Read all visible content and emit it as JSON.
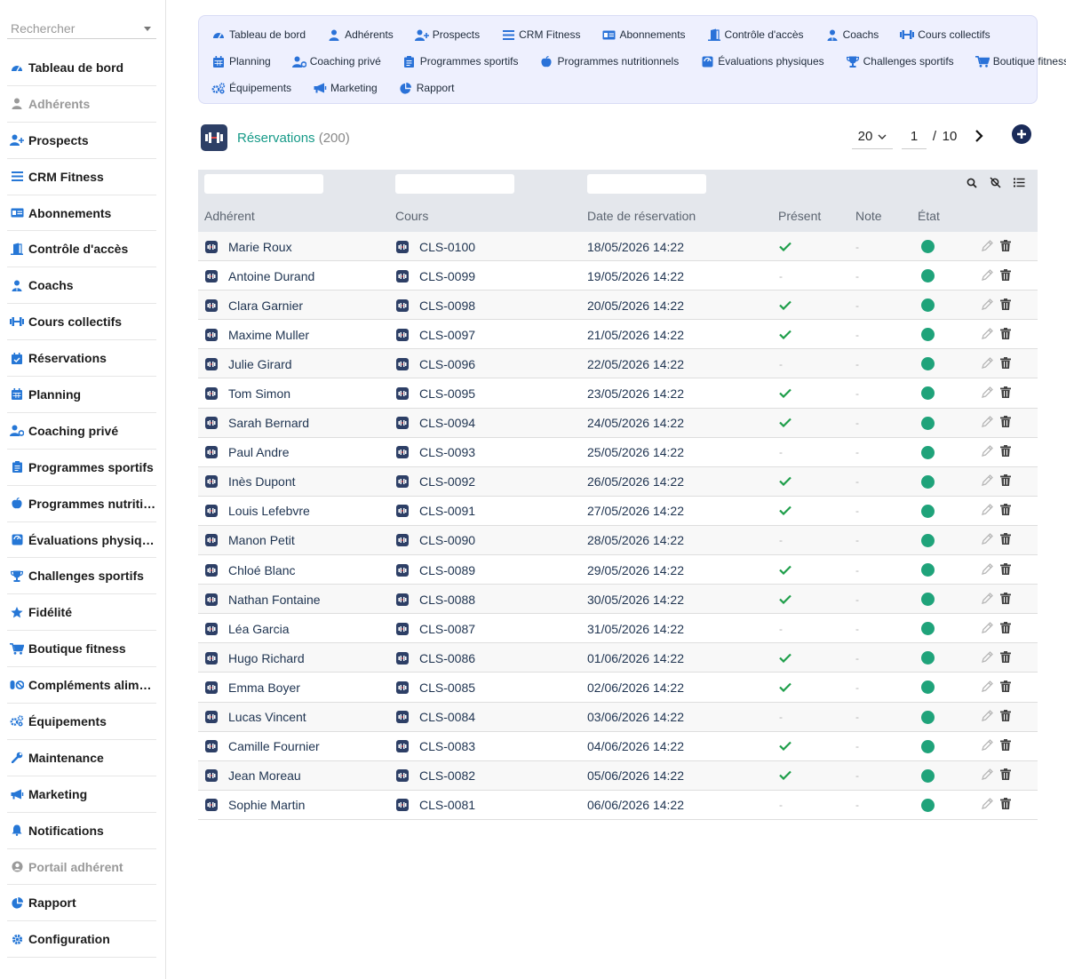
{
  "sidebar": {
    "search_placeholder": "Rechercher",
    "items": [
      {
        "label": "Tableau de bord",
        "icon": "dashboard-icon",
        "muted": false
      },
      {
        "label": "Adhérents",
        "icon": "user-icon",
        "muted": true
      },
      {
        "label": "Prospects",
        "icon": "user-plus-icon",
        "muted": false
      },
      {
        "label": "CRM Fitness",
        "icon": "list-icon",
        "muted": false
      },
      {
        "label": "Abonnements",
        "icon": "id-card-icon",
        "muted": false
      },
      {
        "label": "Contrôle d'accès",
        "icon": "door-icon",
        "muted": false
      },
      {
        "label": "Coachs",
        "icon": "coach-icon",
        "muted": false
      },
      {
        "label": "Cours collectifs",
        "icon": "dumbbell-icon",
        "muted": false
      },
      {
        "label": "Réservations",
        "icon": "calendar-check-icon",
        "muted": false
      },
      {
        "label": "Planning",
        "icon": "calendar-icon",
        "muted": false
      },
      {
        "label": "Coaching privé",
        "icon": "user-cog-icon",
        "muted": false
      },
      {
        "label": "Programmes sportifs",
        "icon": "clipboard-icon",
        "muted": false
      },
      {
        "label": "Programmes nutritionnels",
        "icon": "apple-icon",
        "muted": false
      },
      {
        "label": "Évaluations physiques",
        "icon": "scale-icon",
        "muted": false
      },
      {
        "label": "Challenges sportifs",
        "icon": "trophy-icon",
        "muted": false
      },
      {
        "label": "Fidélité",
        "icon": "star-icon",
        "muted": false
      },
      {
        "label": "Boutique fitness",
        "icon": "cart-icon",
        "muted": false
      },
      {
        "label": "Compléments alimentaires",
        "icon": "pills-icon",
        "muted": false
      },
      {
        "label": "Équipements",
        "icon": "gears-icon",
        "muted": false
      },
      {
        "label": "Maintenance",
        "icon": "wrench-icon",
        "muted": false
      },
      {
        "label": "Marketing",
        "icon": "megaphone-icon",
        "muted": false
      },
      {
        "label": "Notifications",
        "icon": "bell-icon",
        "muted": false
      },
      {
        "label": "Portail adhérent",
        "icon": "user-circle-icon",
        "muted": true
      },
      {
        "label": "Rapport",
        "icon": "pie-icon",
        "muted": false
      },
      {
        "label": "Configuration",
        "icon": "gear-icon",
        "muted": false
      }
    ]
  },
  "topnav": {
    "rows": [
      [
        {
          "label": "Tableau de bord",
          "icon": "dashboard-icon"
        },
        {
          "label": "Adhérents",
          "icon": "user-icon"
        },
        {
          "label": "Prospects",
          "icon": "user-plus-icon"
        },
        {
          "label": "CRM Fitness",
          "icon": "list-icon"
        },
        {
          "label": "Abonnements",
          "icon": "id-card-icon"
        },
        {
          "label": "Contrôle d'accès",
          "icon": "door-icon"
        },
        {
          "label": "Coachs",
          "icon": "coach-icon"
        },
        {
          "label": "Cours collectifs",
          "icon": "dumbbell-icon"
        }
      ],
      [
        {
          "label": "Planning",
          "icon": "calendar-icon"
        },
        {
          "label": "Coaching privé",
          "icon": "user-cog-icon"
        },
        {
          "label": "Programmes sportifs",
          "icon": "clipboard-icon"
        },
        {
          "label": "Programmes nutritionnels",
          "icon": "apple-icon"
        },
        {
          "label": "Évaluations physiques",
          "icon": "scale-icon"
        },
        {
          "label": "Challenges sportifs",
          "icon": "trophy-icon"
        },
        {
          "label": "Boutique fitness",
          "icon": "cart-icon"
        }
      ],
      [
        {
          "label": "Équipements",
          "icon": "gears-icon"
        },
        {
          "label": "Marketing",
          "icon": "megaphone-icon"
        },
        {
          "label": "Rapport",
          "icon": "pie-icon"
        }
      ]
    ]
  },
  "header": {
    "title": "Réservations",
    "count": "(200)",
    "per_page": "20",
    "page_current": "1",
    "page_sep": "/",
    "page_total": "10"
  },
  "table": {
    "columns": [
      "Adhérent",
      "Cours",
      "Date de réservation",
      "Présent",
      "Note",
      "État"
    ],
    "rows": [
      {
        "member": "Marie Roux",
        "course": "CLS-0100",
        "date": "18/05/2026 14:22",
        "present": true,
        "note": "-"
      },
      {
        "member": "Antoine Durand",
        "course": "CLS-0099",
        "date": "19/05/2026 14:22",
        "present": false,
        "note": "-"
      },
      {
        "member": "Clara Garnier",
        "course": "CLS-0098",
        "date": "20/05/2026 14:22",
        "present": true,
        "note": "-"
      },
      {
        "member": "Maxime Muller",
        "course": "CLS-0097",
        "date": "21/05/2026 14:22",
        "present": true,
        "note": "-"
      },
      {
        "member": "Julie Girard",
        "course": "CLS-0096",
        "date": "22/05/2026 14:22",
        "present": false,
        "note": "-"
      },
      {
        "member": "Tom Simon",
        "course": "CLS-0095",
        "date": "23/05/2026 14:22",
        "present": true,
        "note": "-"
      },
      {
        "member": "Sarah Bernard",
        "course": "CLS-0094",
        "date": "24/05/2026 14:22",
        "present": true,
        "note": "-"
      },
      {
        "member": "Paul Andre",
        "course": "CLS-0093",
        "date": "25/05/2026 14:22",
        "present": false,
        "note": "-"
      },
      {
        "member": "Inès Dupont",
        "course": "CLS-0092",
        "date": "26/05/2026 14:22",
        "present": true,
        "note": "-"
      },
      {
        "member": "Louis Lefebvre",
        "course": "CLS-0091",
        "date": "27/05/2026 14:22",
        "present": true,
        "note": "-"
      },
      {
        "member": "Manon Petit",
        "course": "CLS-0090",
        "date": "28/05/2026 14:22",
        "present": false,
        "note": "-"
      },
      {
        "member": "Chloé Blanc",
        "course": "CLS-0089",
        "date": "29/05/2026 14:22",
        "present": true,
        "note": "-"
      },
      {
        "member": "Nathan Fontaine",
        "course": "CLS-0088",
        "date": "30/05/2026 14:22",
        "present": true,
        "note": "-"
      },
      {
        "member": "Léa Garcia",
        "course": "CLS-0087",
        "date": "31/05/2026 14:22",
        "present": false,
        "note": "-"
      },
      {
        "member": "Hugo Richard",
        "course": "CLS-0086",
        "date": "01/06/2026 14:22",
        "present": true,
        "note": "-"
      },
      {
        "member": "Emma Boyer",
        "course": "CLS-0085",
        "date": "02/06/2026 14:22",
        "present": true,
        "note": "-"
      },
      {
        "member": "Lucas Vincent",
        "course": "CLS-0084",
        "date": "03/06/2026 14:22",
        "present": false,
        "note": "-"
      },
      {
        "member": "Camille Fournier",
        "course": "CLS-0083",
        "date": "04/06/2026 14:22",
        "present": true,
        "note": "-"
      },
      {
        "member": "Jean Moreau",
        "course": "CLS-0082",
        "date": "05/06/2026 14:22",
        "present": true,
        "note": "-"
      },
      {
        "member": "Sophie Martin",
        "course": "CLS-0081",
        "date": "06/06/2026 14:22",
        "present": false,
        "note": "-"
      }
    ]
  },
  "colors": {
    "accent": "#2677d6",
    "title": "#169a88",
    "status_ok": "#1fa37a",
    "check": "#1e9e4a",
    "brand_dark": "#1a2b59"
  }
}
